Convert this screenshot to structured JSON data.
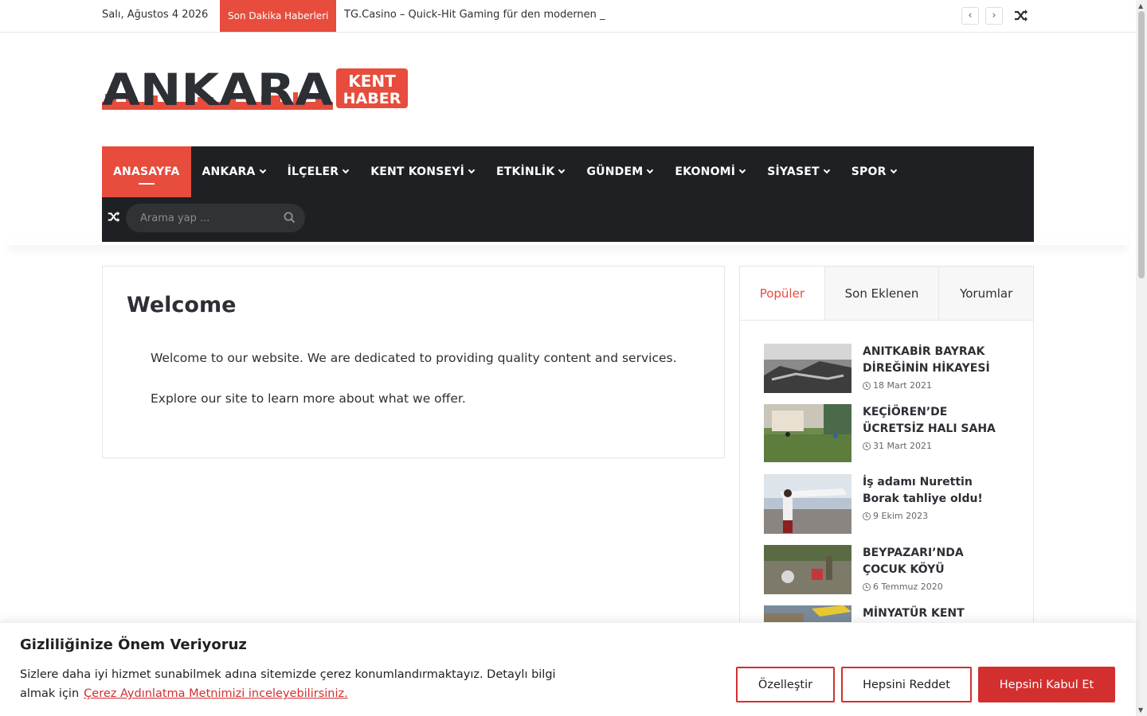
{
  "topbar": {
    "date": "Salı, Ağustos 4 2026",
    "breaking_label": "Son Dakika Haberleri",
    "ticker_text": "TG.Casino – Quick-Hit Gaming für den modernen _",
    "prev_icon": "chevron-left-icon",
    "next_icon": "chevron-right-icon",
    "random_icon": "shuffle-icon"
  },
  "logo": {
    "main": "ANKARA",
    "badge_line1": "KENT",
    "badge_line2": "HABER",
    "brand_color": "#e74c3c"
  },
  "nav": {
    "items": [
      {
        "label": "ANASAYFA",
        "active": true,
        "dropdown": false
      },
      {
        "label": "ANKARA",
        "dropdown": true
      },
      {
        "label": "İLÇELER",
        "dropdown": true
      },
      {
        "label": "KENT KONSEYİ",
        "dropdown": true
      },
      {
        "label": "ETKİNLİK",
        "dropdown": true
      },
      {
        "label": "GÜNDEM",
        "dropdown": true
      },
      {
        "label": "EKONOMİ",
        "dropdown": true
      },
      {
        "label": "SİYASET",
        "dropdown": true
      },
      {
        "label": "SPOR",
        "dropdown": true
      }
    ],
    "search_placeholder": "Arama yap ...",
    "background_color": "#1f2024",
    "active_color": "#e74c3c"
  },
  "main": {
    "title": "Welcome",
    "paragraphs": [
      "Welcome to our website. We are dedicated to providing quality content and services.",
      "Explore our site to learn more about what we offer."
    ]
  },
  "sidebar": {
    "tabs": [
      "Popüler",
      "Son Eklenen",
      "Yorumlar"
    ],
    "active_tab": "Popüler",
    "posts": [
      {
        "title": "ANITKABİR BAYRAK DİREĞİNİN HİKAYESİ",
        "date": "18 Mart 2021"
      },
      {
        "title": "KEÇİÖREN’DE ÜCRETSİZ HALI SAHA",
        "date": "31 Mart 2021"
      },
      {
        "title": "İş adamı Nurettin Borak tahliye oldu!",
        "date": "9 Ekim 2023"
      },
      {
        "title": "BEYPAZARI’NDA ÇOCUK KÖYÜ",
        "date": "6 Temmuz 2020"
      },
      {
        "title": "MİNYATÜR KENT",
        "date": ""
      }
    ]
  },
  "cookie": {
    "title": "Gizliliğinize Önem Veriyoruz",
    "text": "Sizlere daha iyi hizmet sunabilmek adına sitemizde çerez konumlandırmaktayız. Detaylı bilgi almak için",
    "link_text": "Çerez Aydınlatma Metnimizi inceleyebilirsiniz.",
    "customize_label": "Özelleştir",
    "reject_label": "Hepsini Reddet",
    "accept_label": "Hepsini Kabul Et",
    "accent_color": "#d32f2f"
  }
}
